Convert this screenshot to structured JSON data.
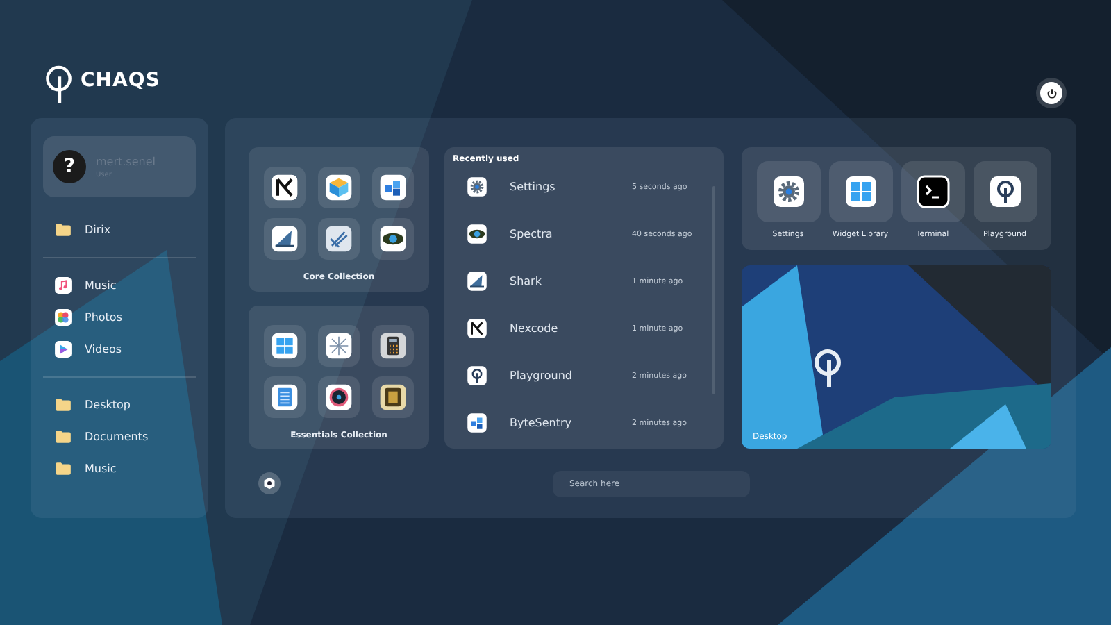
{
  "brand": {
    "name": "CHAQS"
  },
  "user": {
    "name": "mert.senel",
    "role": "User",
    "avatar": "?"
  },
  "sidebar": {
    "groups": [
      {
        "items": [
          {
            "label": "Dirix",
            "kind": "folder"
          }
        ]
      },
      {
        "items": [
          {
            "label": "Music",
            "kind": "music"
          },
          {
            "label": "Photos",
            "kind": "photos"
          },
          {
            "label": "Videos",
            "kind": "videos"
          }
        ]
      },
      {
        "items": [
          {
            "label": "Desktop",
            "kind": "folder"
          },
          {
            "label": "Documents",
            "kind": "folder"
          },
          {
            "label": "Music",
            "kind": "folder"
          }
        ]
      }
    ]
  },
  "collections": [
    {
      "title": "Core Collection",
      "apps": [
        {
          "kind": "x"
        },
        {
          "kind": "cube"
        },
        {
          "kind": "cubes"
        },
        {
          "kind": "shark"
        },
        {
          "kind": "tool"
        },
        {
          "kind": "eye"
        }
      ]
    },
    {
      "title": "Essentials Collection",
      "apps": [
        {
          "kind": "grid"
        },
        {
          "kind": "burst"
        },
        {
          "kind": "calculator"
        },
        {
          "kind": "notes"
        },
        {
          "kind": "ring"
        },
        {
          "kind": "cards"
        }
      ]
    }
  ],
  "recent": {
    "title": "Recently used",
    "items": [
      {
        "name": "Settings",
        "time": "5 seconds ago",
        "kind": "gear"
      },
      {
        "name": "Spectra",
        "time": "40 seconds ago",
        "kind": "eye"
      },
      {
        "name": "Shark",
        "time": "1 minute ago",
        "kind": "shark"
      },
      {
        "name": "Nexcode",
        "time": "1 minute ago",
        "kind": "x"
      },
      {
        "name": "Playground",
        "time": "2 minutes ago",
        "kind": "logo"
      },
      {
        "name": "ByteSentry",
        "time": "2 minutes ago",
        "kind": "cubes"
      }
    ]
  },
  "pinned": [
    {
      "label": "Settings",
      "kind": "gear"
    },
    {
      "label": "Widget Library",
      "kind": "grid"
    },
    {
      "label": "Terminal",
      "kind": "terminal"
    },
    {
      "label": "Playground",
      "kind": "logo"
    }
  ],
  "desktop_preview": {
    "label": "Desktop"
  },
  "search": {
    "placeholder": "Search here"
  }
}
